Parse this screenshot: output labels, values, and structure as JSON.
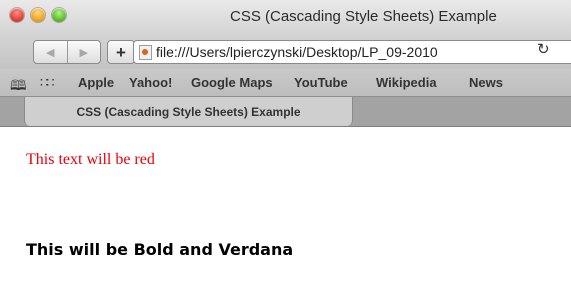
{
  "window": {
    "title": "CSS (Cascading Style Sheets) Example"
  },
  "toolbar": {
    "back_icon": "◀",
    "forward_icon": "▶",
    "add_icon": "+",
    "url": "file:///Users/lpierczynski/Desktop/LP_09-2010",
    "reload_icon": "↻"
  },
  "bookmarks": {
    "reader_icon": "book-icon",
    "topsites_icon": "grid-icon",
    "items": [
      {
        "label": "Apple"
      },
      {
        "label": "Yahoo!"
      },
      {
        "label": "Google Maps"
      },
      {
        "label": "YouTube"
      },
      {
        "label": "Wikipedia"
      },
      {
        "label": "News"
      }
    ]
  },
  "tabs": [
    {
      "label": "CSS (Cascading Style Sheets) Example"
    }
  ],
  "content": {
    "red_text": "This text will be red",
    "bold_text": "This will be Bold and Verdana",
    "red_color": "#e8000b"
  }
}
